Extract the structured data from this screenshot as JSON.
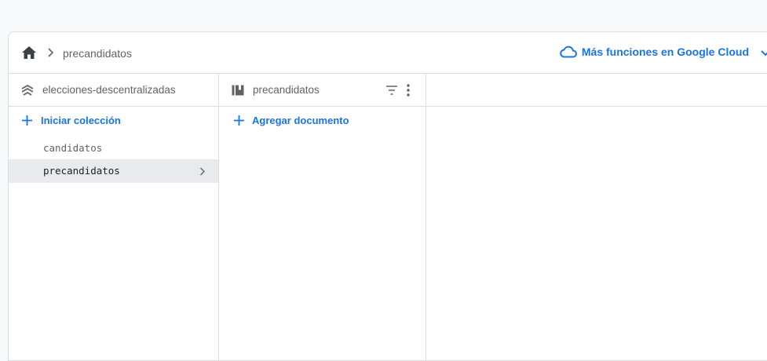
{
  "breadcrumb": {
    "home_icon": "home-icon",
    "separator_icon": "chevron-right-icon",
    "current": "precandidatos"
  },
  "cloud_link": {
    "label": "Más funciones en Google Cloud",
    "icon": "cloud-icon",
    "dropdown_icon": "chevron-down-icon",
    "color": "#1a73e8"
  },
  "panels": {
    "database": {
      "icon": "database-icon",
      "title": "elecciones-descentralizadas",
      "action_label": "Iniciar colección",
      "items": [
        {
          "label": "candidatos",
          "selected": false
        },
        {
          "label": "precandidatos",
          "selected": true
        }
      ]
    },
    "collection": {
      "icon": "collection-icon",
      "title": "precandidatos",
      "filter_icon": "filter-icon",
      "more_icon": "more-vert-icon",
      "action_label": "Agregar documento"
    }
  }
}
